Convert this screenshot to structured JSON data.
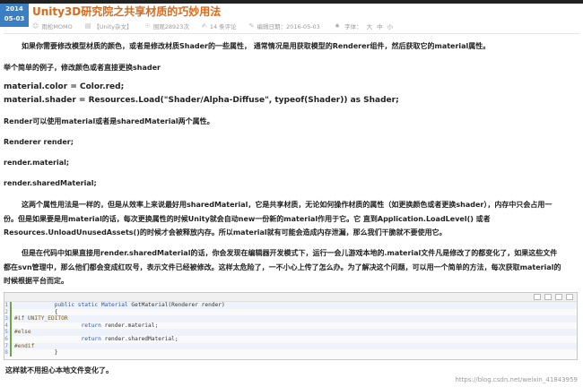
{
  "date_badge": {
    "year": "2014",
    "month_day": "05-03"
  },
  "title": "Unity3D研究院之共享材质的巧妙用法",
  "meta": {
    "author": "雨松MOMO",
    "category": "【Unity杂文】",
    "views": "围观28923次",
    "comments": "14 条评论",
    "edit_date": "编辑日期：2016-05-03",
    "font_label": "字体：",
    "font_sizes": [
      "大",
      "中",
      "小"
    ]
  },
  "content": {
    "p1": "如果你需要修改模型材质的颜色，或者是修改材质Shader的一些属性，  通常情况是用获取模型的Renderer组件，然后获取它的material属性。",
    "p2": "举个简单的例子，修改颜色或者直接更换shader",
    "code1": "material.color = Color.red;",
    "code2": "material.shader = Resources.Load(\"Shader/Alpha-Diffuse\", typeof(Shader)) as Shader;",
    "p3": "Render可以使用material或者是sharedMaterial两个属性。",
    "p4": "Renderer render;",
    "p5": "render.material;",
    "p6": "render.sharedMaterial;",
    "p7a": "这两个属性用法是一样的，但是从效率上来说最好用sharedMaterial，它是共享材质，无论如何操作材质的属性（如更换颜色或者更换shader），内存中只会占用一",
    "p7b": "份。但是如果要是用material的话，每次更换属性的时候Unity就会自动new一份新的material作用于它。它 直到Application.LoadLevel() 或者",
    "p7c": "Resources.UnloadUnusedAssets()的时候才会被释放内存。所以material就有可能会造成内存泄漏，那么我们干脆就不要使用它。",
    "p8a": "但是在代码中如果直接用render.sharedMaterial的话，你会发现在编辑器开发模式下，运行一会儿游戏本地的.material文件凡是修改了的都变化了，如果这些文件",
    "p8b": "都在svn管理中，那么他们都会变成红叹号，表示文件已经被修改。这样太危险了，一不小心上传了怎么办。为了解决这个问题，可以用一个简单的方法，每次获取material的",
    "p8c": "时候根据平台而定。",
    "footer": "这样就不用担心本地文件变化了。"
  },
  "code_lines": [
    {
      "n": "1",
      "parts": [
        [
          "",
          "            "
        ],
        [
          "kw",
          "public static"
        ],
        [
          "",
          " "
        ],
        [
          "kw",
          "Material"
        ],
        [
          "",
          " GetMaterial(Renderer render)"
        ]
      ]
    },
    {
      "n": "2",
      "parts": [
        [
          "",
          "            {"
        ]
      ]
    },
    {
      "n": "3",
      "parts": [
        [
          "pp",
          "#if UNITY_EDITOR"
        ]
      ]
    },
    {
      "n": "4",
      "parts": [
        [
          "",
          "                    "
        ],
        [
          "kw",
          "return"
        ],
        [
          "",
          " render.material;"
        ]
      ]
    },
    {
      "n": "5",
      "parts": [
        [
          "pp",
          "#else"
        ]
      ]
    },
    {
      "n": "6",
      "parts": [
        [
          "",
          "                    "
        ],
        [
          "kw",
          "return"
        ],
        [
          "",
          " render.sharedMaterial;"
        ]
      ]
    },
    {
      "n": "7",
      "parts": [
        [
          "pp",
          "#endif"
        ]
      ]
    },
    {
      "n": "8",
      "parts": [
        [
          "",
          "            }"
        ]
      ]
    }
  ],
  "watermark": "https://blog.csdn.net/weixin_41843959",
  "colors": {
    "title": "#d86a1a",
    "badge": "#3a7fc2",
    "keyword": "#1f55c2"
  },
  "icons": [
    "user-icon",
    "folder-icon",
    "eye-icon",
    "comment-icon",
    "edit-icon",
    "font-icon"
  ]
}
